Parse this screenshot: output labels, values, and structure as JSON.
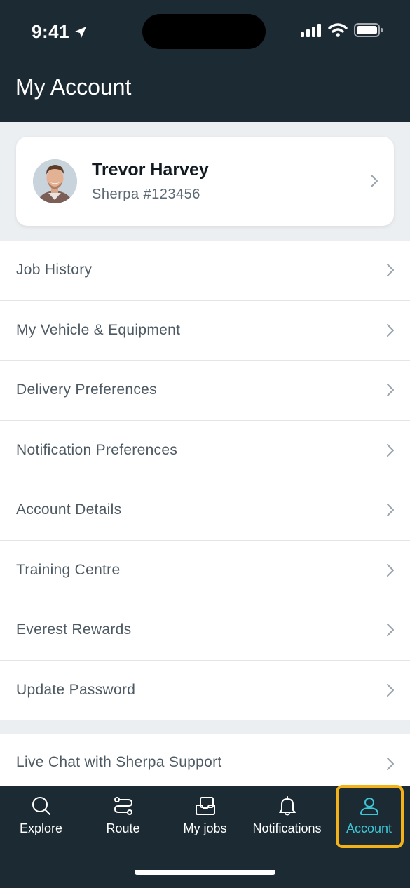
{
  "status_bar": {
    "time": "9:41",
    "icons": [
      "location-arrow-icon",
      "signal-icon",
      "wifi-icon",
      "battery-icon"
    ]
  },
  "header": {
    "title": "My Account"
  },
  "profile": {
    "name": "Trevor Harvey",
    "subtitle": "Sherpa #123456"
  },
  "menu": {
    "items": [
      {
        "label": "Job History"
      },
      {
        "label": "My Vehicle & Equipment"
      },
      {
        "label": "Delivery Preferences"
      },
      {
        "label": "Notification Preferences"
      },
      {
        "label": "Account Details"
      },
      {
        "label": "Training Centre"
      },
      {
        "label": "Everest Rewards"
      },
      {
        "label": "Update Password"
      }
    ]
  },
  "support": {
    "label": "Live Chat with Sherpa Support"
  },
  "tabbar": {
    "tabs": [
      {
        "label": "Explore",
        "icon": "search-icon"
      },
      {
        "label": "Route",
        "icon": "route-icon"
      },
      {
        "label": "My jobs",
        "icon": "jobs-icon"
      },
      {
        "label": "Notifications",
        "icon": "bell-icon"
      },
      {
        "label": "Account",
        "icon": "user-icon",
        "active": true
      }
    ]
  },
  "colors": {
    "header_bg": "#1c2a33",
    "page_bg": "#eceff2",
    "accent": "#3dc6d6",
    "highlight": "#f4b21a"
  }
}
